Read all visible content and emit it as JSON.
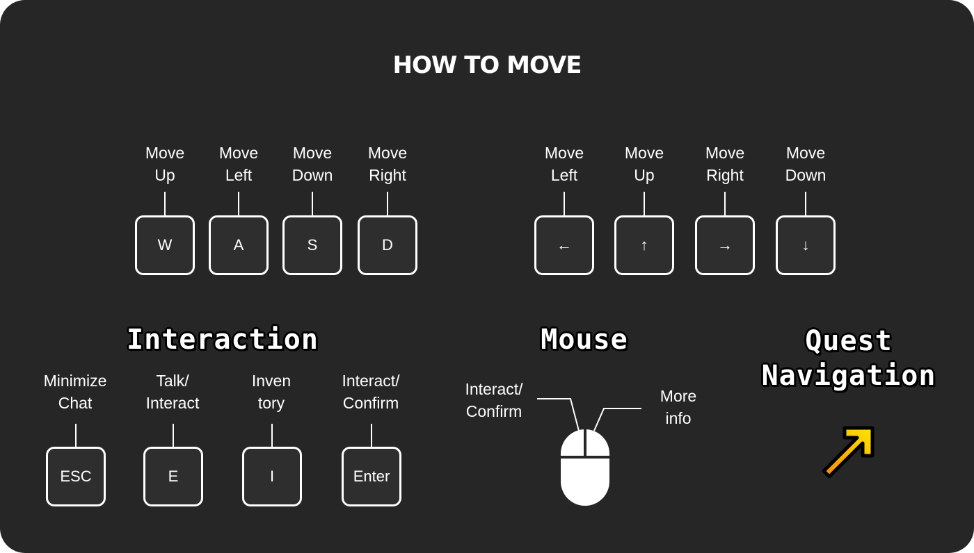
{
  "title": "HOW TO MOVE",
  "wasd": [
    {
      "key": "W",
      "label": "Move\nUp"
    },
    {
      "key": "A",
      "label": "Move\nLeft"
    },
    {
      "key": "S",
      "label": "Move\nDown"
    },
    {
      "key": "D",
      "label": "Move\nRight"
    }
  ],
  "arrows": [
    {
      "key": "←",
      "label": "Move\nLeft",
      "icon": "arrow-left-icon"
    },
    {
      "key": "↑",
      "label": "Move\nUp",
      "icon": "arrow-up-icon"
    },
    {
      "key": "→",
      "label": "Move\nRight",
      "icon": "arrow-right-icon"
    },
    {
      "key": "↓",
      "label": "Move\nDown",
      "icon": "arrow-down-icon"
    }
  ],
  "interaction": {
    "heading": "Interaction",
    "keys": [
      {
        "key": "ESC",
        "label": "Minimize\nChat"
      },
      {
        "key": "E",
        "label": "Talk/\nInteract"
      },
      {
        "key": "I",
        "label": "Inven\ntory"
      },
      {
        "key": "Enter",
        "label": "Interact/\nConfirm"
      }
    ]
  },
  "mouse": {
    "heading": "Mouse",
    "left_label": "Interact/\nConfirm",
    "right_label": "More\ninfo",
    "icon": "mouse-icon"
  },
  "quest": {
    "heading": "Quest\nNavigation",
    "icon": "quest-arrow-icon",
    "colors": {
      "arrow_top": "#ffe600",
      "arrow_bottom": "#f28a1a",
      "outline": "#000000"
    }
  }
}
